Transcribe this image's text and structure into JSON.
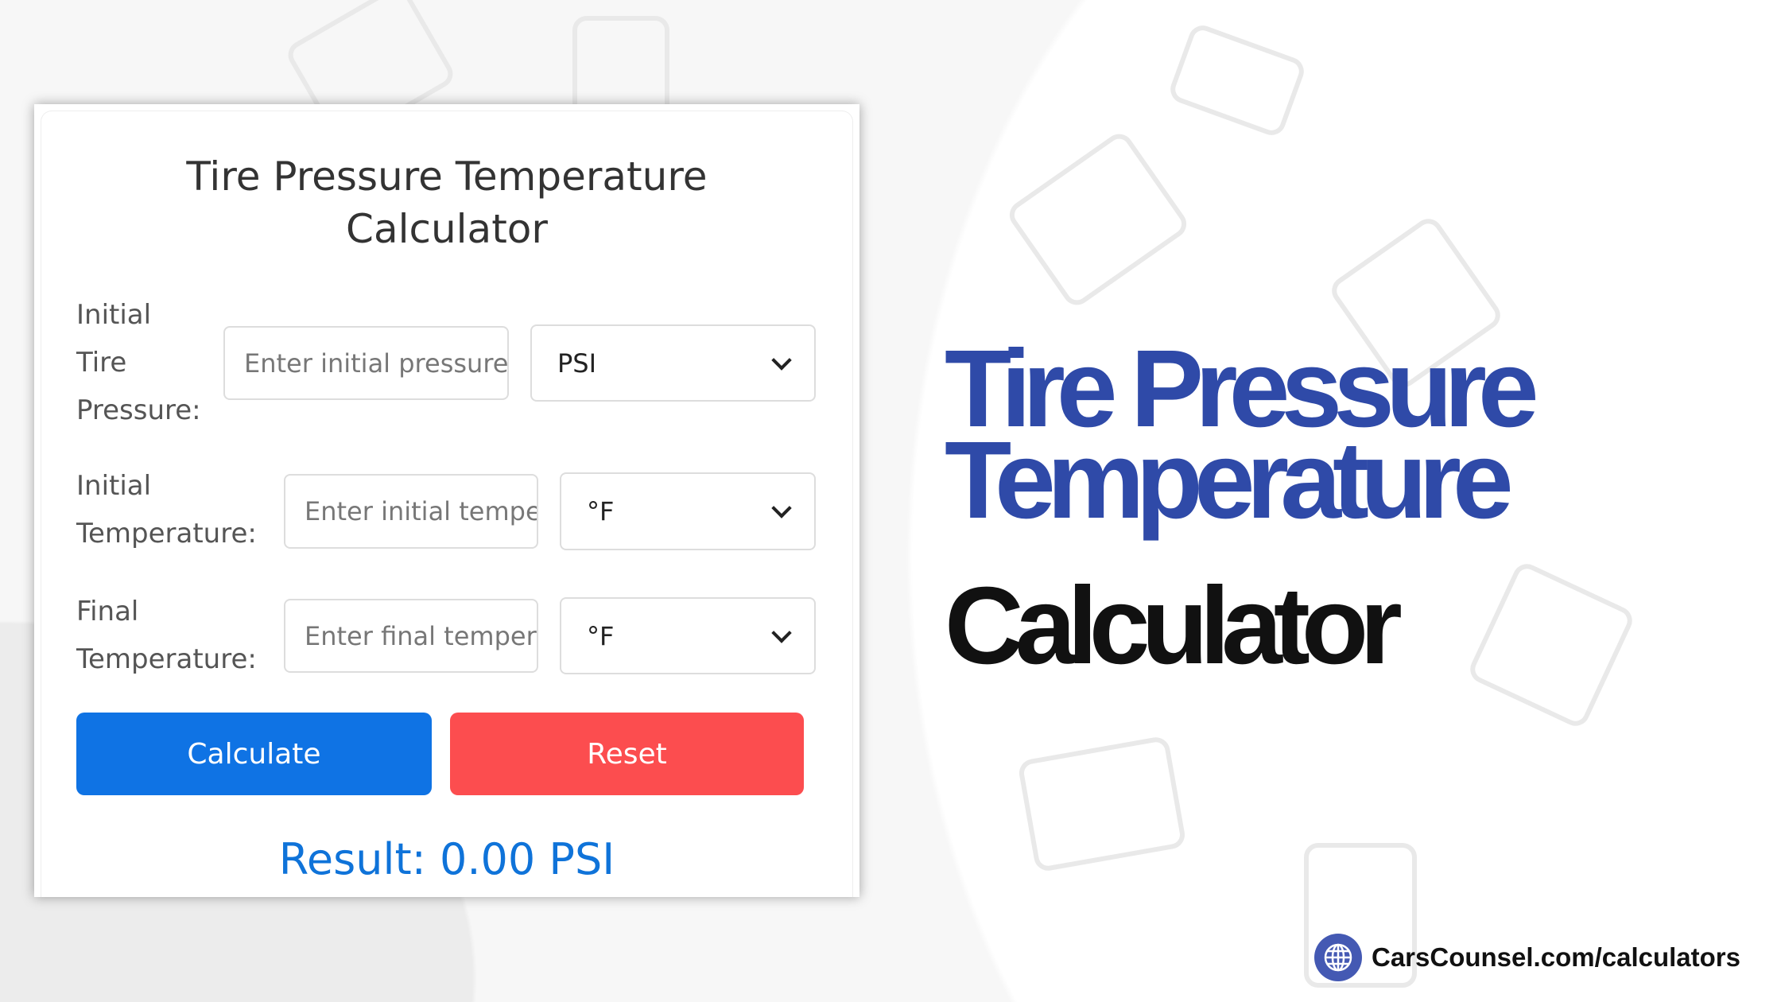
{
  "calculator": {
    "title_line1": "Tire Pressure Temperature",
    "title_line2": "Calculator",
    "rows": [
      {
        "label_lines": [
          "Initial",
          "Tire",
          "Pressure:"
        ],
        "placeholder": "Enter initial pressure",
        "unit": "PSI"
      },
      {
        "label_lines": [
          "Initial",
          "Temperature:"
        ],
        "placeholder": "Enter initial temperature",
        "unit": "°F"
      },
      {
        "label_lines": [
          "Final",
          "Temperature:"
        ],
        "placeholder": "Enter final temperature",
        "unit": "°F"
      }
    ],
    "calculate_label": "Calculate",
    "reset_label": "Reset",
    "result_text": "Result: 0.00 PSI"
  },
  "headline": {
    "line1": "Tire Pressure",
    "line2": "Temperature",
    "line3": "Calculator"
  },
  "footer": {
    "url": "CarsCounsel.com/calculators",
    "icon": "globe-icon"
  },
  "colors": {
    "calculate": "#0f73e4",
    "reset": "#fc4d4f",
    "result": "#0f73d9",
    "headline_blue": "#2f4aa8",
    "globe_bg": "#4459b3"
  }
}
